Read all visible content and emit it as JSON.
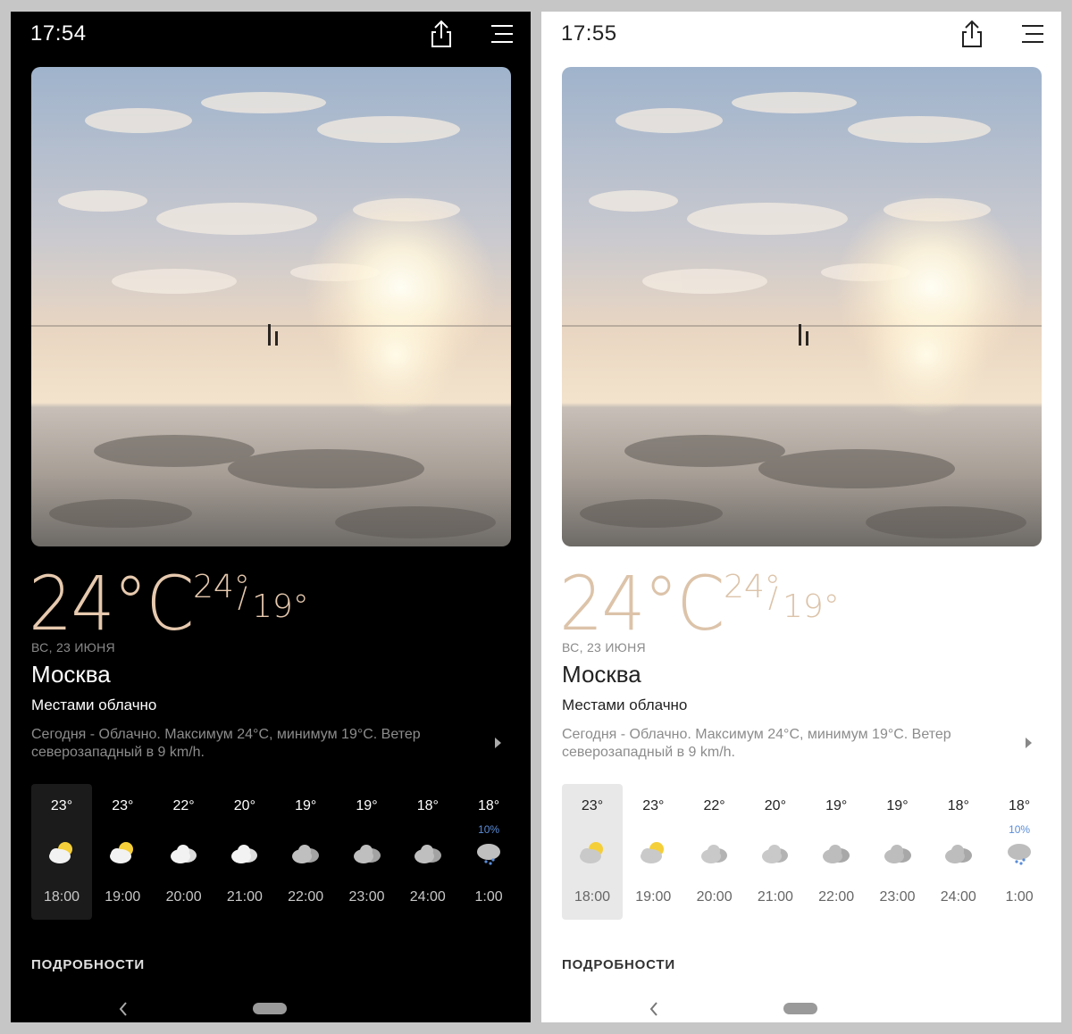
{
  "screens": [
    {
      "theme": "dark",
      "status_time": "17:54",
      "current": {
        "temp": "24°C",
        "hi": "24°",
        "separator": "/",
        "lo": "19°",
        "date": "ВС, 23 ИЮНЯ",
        "city": "Москва",
        "condition": "Местами облачно",
        "summary": "Сегодня - Облачно. Максимум 24°C, минимум 19°C. Ветер северозападный в 9 km/h."
      },
      "hourly": [
        {
          "temp": "23°",
          "precip": "",
          "time": "18:00",
          "icon": "partly-cloudy-icon",
          "selected": true
        },
        {
          "temp": "23°",
          "precip": "",
          "time": "19:00",
          "icon": "partly-cloudy-icon",
          "selected": false
        },
        {
          "temp": "22°",
          "precip": "",
          "time": "20:00",
          "icon": "cloudy-icon",
          "selected": false
        },
        {
          "temp": "20°",
          "precip": "",
          "time": "21:00",
          "icon": "cloudy-icon",
          "selected": false
        },
        {
          "temp": "19°",
          "precip": "",
          "time": "22:00",
          "icon": "overcast-icon",
          "selected": false
        },
        {
          "temp": "19°",
          "precip": "",
          "time": "23:00",
          "icon": "overcast-icon",
          "selected": false
        },
        {
          "temp": "18°",
          "precip": "",
          "time": "24:00",
          "icon": "overcast-icon",
          "selected": false
        },
        {
          "temp": "18°",
          "precip": "10%",
          "time": "1:00",
          "icon": "rain-cloud-icon",
          "selected": false
        }
      ],
      "details_label": "ПОДРОБНОСТИ"
    },
    {
      "theme": "light",
      "status_time": "17:55",
      "current": {
        "temp": "24°C",
        "hi": "24°",
        "separator": "/",
        "lo": "19°",
        "date": "ВС, 23 ИЮНЯ",
        "city": "Москва",
        "condition": "Местами облачно",
        "summary": "Сегодня - Облачно. Максимум 24°C, минимум 19°C. Ветер северозападный в 9 km/h."
      },
      "hourly": [
        {
          "temp": "23°",
          "precip": "",
          "time": "18:00",
          "icon": "partly-cloudy-icon",
          "selected": true
        },
        {
          "temp": "23°",
          "precip": "",
          "time": "19:00",
          "icon": "partly-cloudy-icon",
          "selected": false
        },
        {
          "temp": "22°",
          "precip": "",
          "time": "20:00",
          "icon": "cloudy-icon",
          "selected": false
        },
        {
          "temp": "20°",
          "precip": "",
          "time": "21:00",
          "icon": "cloudy-icon",
          "selected": false
        },
        {
          "temp": "19°",
          "precip": "",
          "time": "22:00",
          "icon": "overcast-icon",
          "selected": false
        },
        {
          "temp": "19°",
          "precip": "",
          "time": "23:00",
          "icon": "overcast-icon",
          "selected": false
        },
        {
          "temp": "18°",
          "precip": "",
          "time": "24:00",
          "icon": "overcast-icon",
          "selected": false
        },
        {
          "temp": "18°",
          "precip": "10%",
          "time": "1:00",
          "icon": "rain-cloud-icon",
          "selected": false
        }
      ],
      "details_label": "ПОДРОБНОСТИ"
    }
  ],
  "colors": {
    "temp_accent": "#e6c9ae",
    "precip_blue": "#5a8dd8",
    "sun_yellow": "#f5cf3a"
  }
}
